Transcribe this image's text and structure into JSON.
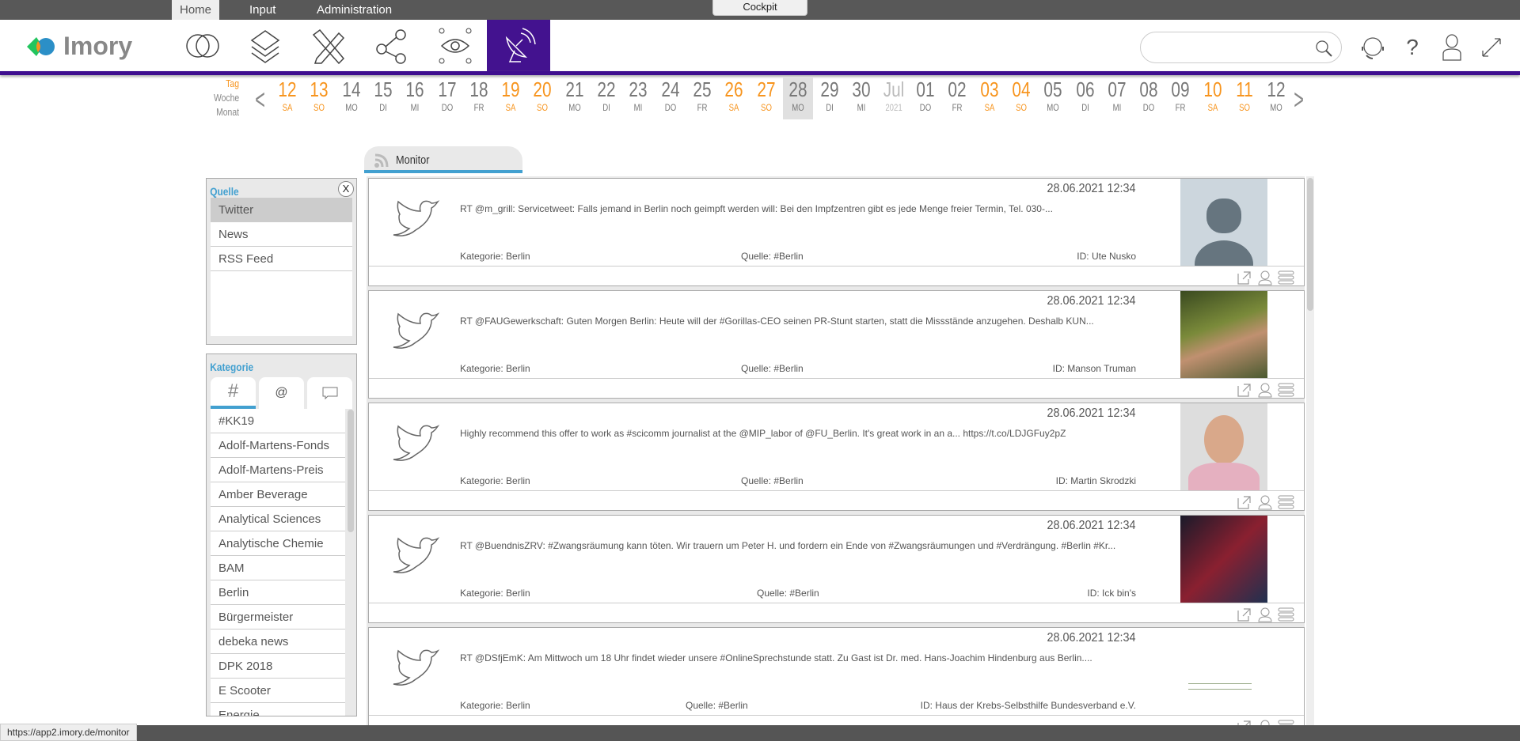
{
  "topnav": {
    "tabs": [
      "Home",
      "Input",
      "Administration"
    ],
    "active": "Home",
    "cockpit": "Cockpit"
  },
  "brand": {
    "name": "Imory"
  },
  "nav_icons": [
    "venn-icon",
    "layers-icon",
    "pencil-ruler-icon",
    "share-icon",
    "eye-network-icon",
    "satellite-dish-icon"
  ],
  "search": {
    "value": "",
    "placeholder": ""
  },
  "header_icons": [
    "support-headset-icon",
    "help-icon",
    "user-icon",
    "expand-icon"
  ],
  "calendar": {
    "modes": [
      "Tag",
      "Woche",
      "Monat"
    ],
    "active_mode": "Tag",
    "days": [
      {
        "n": "12",
        "w": "SA",
        "we": true
      },
      {
        "n": "13",
        "w": "SO",
        "we": true
      },
      {
        "n": "14",
        "w": "MO"
      },
      {
        "n": "15",
        "w": "DI"
      },
      {
        "n": "16",
        "w": "MI"
      },
      {
        "n": "17",
        "w": "DO"
      },
      {
        "n": "18",
        "w": "FR"
      },
      {
        "n": "19",
        "w": "SA",
        "we": true
      },
      {
        "n": "20",
        "w": "SO",
        "we": true
      },
      {
        "n": "21",
        "w": "MO"
      },
      {
        "n": "22",
        "w": "DI"
      },
      {
        "n": "23",
        "w": "MI"
      },
      {
        "n": "24",
        "w": "DO"
      },
      {
        "n": "25",
        "w": "FR"
      },
      {
        "n": "26",
        "w": "SA",
        "we": true
      },
      {
        "n": "27",
        "w": "SO",
        "we": true
      },
      {
        "n": "28",
        "w": "MO",
        "sel": true
      },
      {
        "n": "29",
        "w": "DI"
      },
      {
        "n": "30",
        "w": "MI"
      },
      {
        "n": "Jul",
        "w": "2021",
        "mon": true
      },
      {
        "n": "01",
        "w": "DO"
      },
      {
        "n": "02",
        "w": "FR"
      },
      {
        "n": "03",
        "w": "SA",
        "we": true
      },
      {
        "n": "04",
        "w": "SO",
        "we": true
      },
      {
        "n": "05",
        "w": "MO"
      },
      {
        "n": "06",
        "w": "DI"
      },
      {
        "n": "07",
        "w": "MI"
      },
      {
        "n": "08",
        "w": "DO"
      },
      {
        "n": "09",
        "w": "FR"
      },
      {
        "n": "10",
        "w": "SA",
        "we": true
      },
      {
        "n": "11",
        "w": "SO",
        "we": true
      },
      {
        "n": "12",
        "w": "MO"
      }
    ]
  },
  "monitor_tab": {
    "label": "Monitor"
  },
  "quelle": {
    "title": "Quelle",
    "close": "X",
    "items": [
      "Twitter",
      "News",
      "RSS Feed"
    ],
    "selected": "Twitter"
  },
  "kategorie": {
    "title": "Kategorie",
    "tabs": [
      "hashtag-icon",
      "at-satellite-icon",
      "comment-icon"
    ],
    "items": [
      "#KK19",
      "Adolf-Martens-Fonds",
      "Adolf-Martens-Preis",
      "Amber Beverage",
      "Analytical Sciences",
      "Analytische Chemie",
      "BAM",
      "Berlin",
      "Bürgermeister",
      "debeka news",
      "DPK 2018",
      "E Scooter",
      "Energie"
    ]
  },
  "posts": [
    {
      "date": "28.06.2021 12:34",
      "text": "RT @m_grill: Servicetweet: Falls jemand in Berlin noch geimpft werden will: Bei den Impfzentren gibt es jede Menge freier Termin, Tel. 030-...",
      "kategorie": "Kategorie: Berlin",
      "quelle": "Quelle: #Berlin",
      "id": "ID: Ute Nusko",
      "pic": "default-avatar"
    },
    {
      "date": "28.06.2021 12:34",
      "text": "RT @FAUGewerkschaft: Guten Morgen Berlin: Heute will der #Gorillas-CEO seinen PR-Stunt starten, statt die Missstände anzugehen. Deshalb KUN...",
      "kategorie": "Kategorie: Berlin",
      "quelle": "Quelle: #Berlin",
      "id": "ID: Manson Truman",
      "pic": "photo-green"
    },
    {
      "date": "28.06.2021 12:34",
      "text": "Highly recommend this offer to work as #scicomm journalist at the @MIP_labor of @FU_Berlin. It's great work in an a... https://t.co/LDJGFuy2pZ",
      "kategorie": "Kategorie: Berlin",
      "quelle": "Quelle: #Berlin",
      "id": "ID: Martin Skrodzki",
      "pic": "photo-face"
    },
    {
      "date": "28.06.2021 12:34",
      "text": "RT @BuendnisZRV: #Zwangsräumung kann töten. Wir trauern um Peter H. und fordern ein Ende von #Zwangsräumungen und #Verdrängung. #Berlin #Kr...",
      "kategorie": "Kategorie: Berlin",
      "quelle": "Quelle: #Berlin",
      "id": "ID: Ick bin's",
      "pic": "photo-dark"
    },
    {
      "date": "28.06.2021 12:34",
      "text": "RT @DSfjEmK: Am Mittwoch um 18 Uhr findet wieder unsere #OnlineSprechstunde statt. Zu Gast ist Dr. med. Hans-Joachim Hindenburg aus Berlin....",
      "kategorie": "Kategorie: Berlin",
      "quelle": "Quelle: #Berlin",
      "id": "ID: Haus der Krebs-Selbsthilfe Bundesverband e.V.",
      "pic": "logo-green"
    }
  ],
  "post_actions": [
    "external-link-icon",
    "user-icon",
    "menu-icon"
  ],
  "status": {
    "url": "https://app2.imory.de/monitor"
  },
  "colors": {
    "accent": "#43128f",
    "weekend": "#f7941d",
    "link_blue": "#42a0d0"
  }
}
